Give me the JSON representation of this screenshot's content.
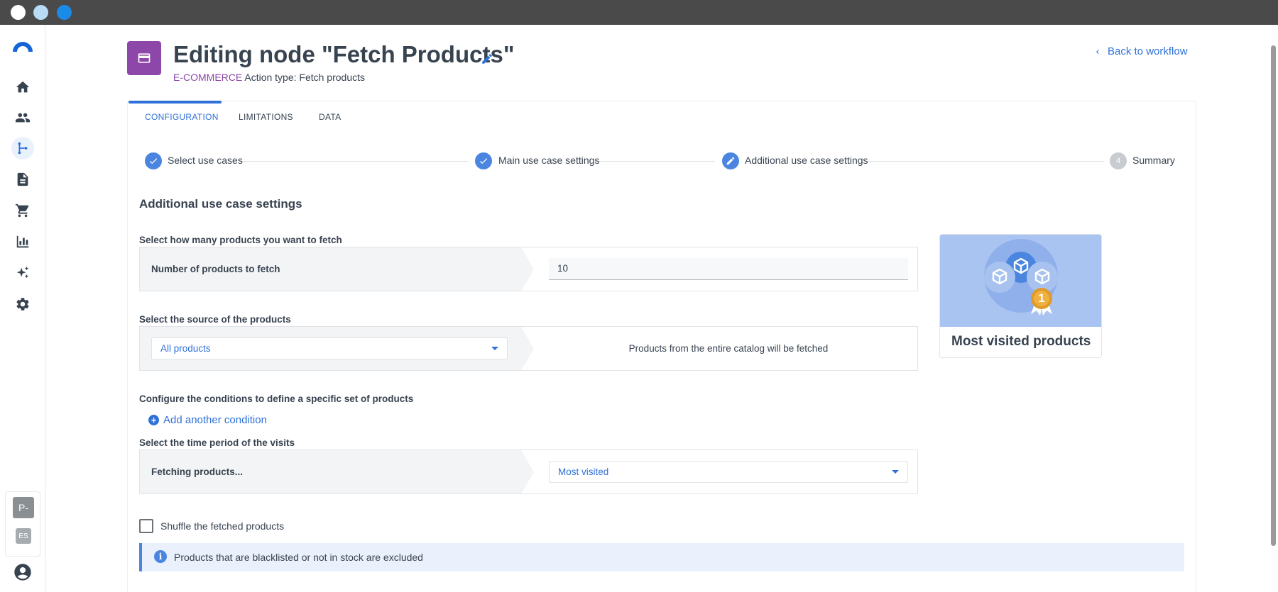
{
  "window": {
    "title_bar": ""
  },
  "sidebar": {
    "items": [
      {
        "name": "home-icon"
      },
      {
        "name": "people-icon"
      },
      {
        "name": "workflow-icon",
        "active": true
      },
      {
        "name": "document-icon"
      },
      {
        "name": "cart-icon"
      },
      {
        "name": "analytics-icon"
      },
      {
        "name": "sparkle-icon"
      },
      {
        "name": "gear-icon"
      }
    ],
    "user_initial": "P-",
    "language": "ES"
  },
  "header": {
    "title": "Editing node \"Fetch Products\"",
    "category": "E-COMMERCE",
    "action_type": "Action type: Fetch products",
    "back_link": "Back to workflow"
  },
  "tabs": [
    {
      "label": "CONFIGURATION",
      "active": true
    },
    {
      "label": "LIMITATIONS",
      "active": false
    },
    {
      "label": "DATA",
      "active": false
    }
  ],
  "stepper": {
    "steps": [
      {
        "label": "Select use cases",
        "state": "done"
      },
      {
        "label": "Main use case settings",
        "state": "done"
      },
      {
        "label": "Additional use case settings",
        "state": "current"
      },
      {
        "label": "Summary",
        "state": "pending",
        "number": "4"
      }
    ]
  },
  "form": {
    "heading": "Additional use case settings",
    "products_count": {
      "label": "Select how many products you want to fetch",
      "row_label": "Number of products to fetch",
      "value": "10"
    },
    "source": {
      "label": "Select the source of the products",
      "selected": "All products",
      "description": "Products from the entire catalog will be fetched"
    },
    "conditions": {
      "label": "Configure the conditions to define a specific set of products",
      "add_label": "Add another condition"
    },
    "time_period": {
      "label": "Select the time period of the visits",
      "row_label": "Fetching products...",
      "selected": "Most visited"
    },
    "shuffle": {
      "label": "Shuffle the fetched products",
      "checked": false
    },
    "info": "Products that are blacklisted or not in stock are excluded"
  },
  "use_case_card": {
    "title": "Most visited products",
    "badge": "1"
  },
  "colors": {
    "accent": "#2f71d8",
    "category": "#8c47a8",
    "card_image_bg": "#aac4f2",
    "badge": "#e09a2a"
  }
}
